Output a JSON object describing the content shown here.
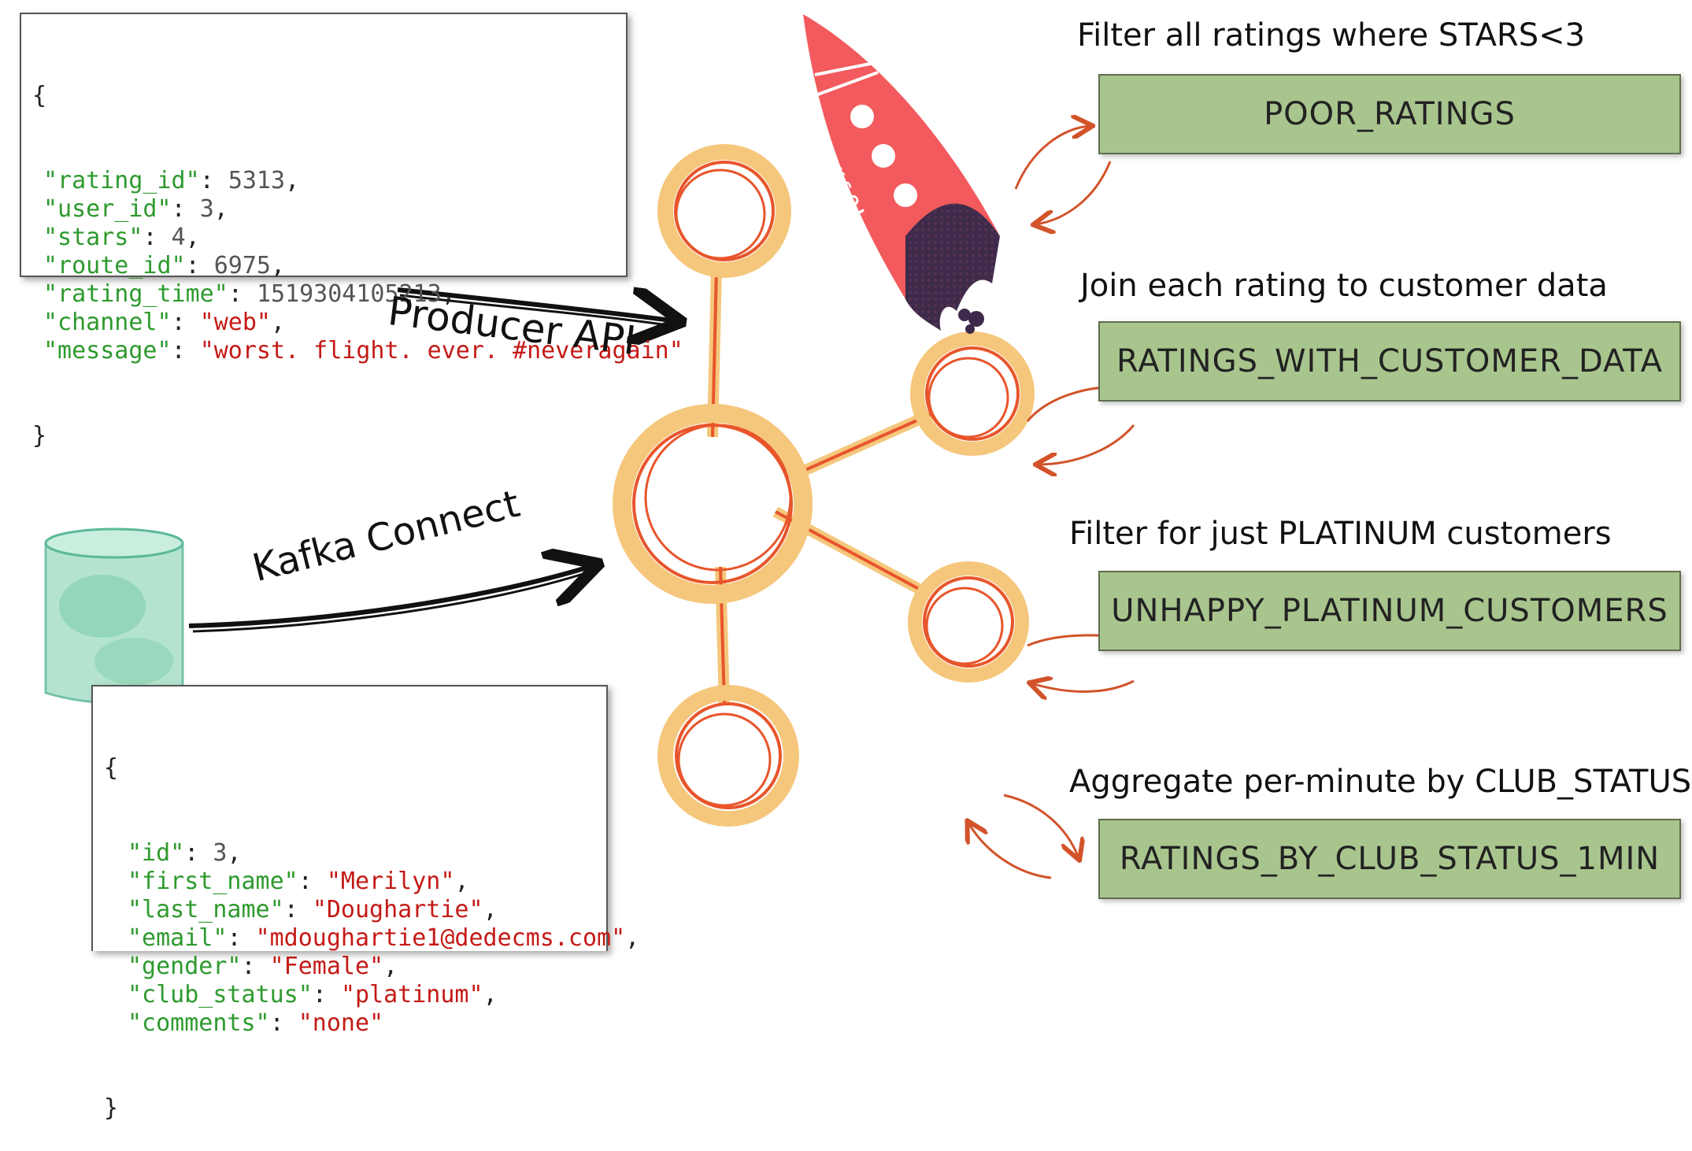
{
  "colors": {
    "broker_stroke": "#e8552b",
    "broker_glow": "#f5c77c",
    "stream_fill": "#a9c58e",
    "arrow": "#d2532a",
    "rocket_body": "#f25a5d",
    "rocket_dark": "#3e2a4a",
    "db_fill": "#8fd3b5",
    "json_key": "#2e9a2e",
    "json_string": "#c41a16"
  },
  "rating_event": {
    "open": "{",
    "close": "}",
    "fields": [
      {
        "key": "\"rating_id\"",
        "sep": ": ",
        "value": "5313",
        "kind": "n",
        "tail": ","
      },
      {
        "key": "\"user_id\"",
        "sep": ": ",
        "value": "3",
        "kind": "n",
        "tail": ","
      },
      {
        "key": "\"stars\"",
        "sep": ": ",
        "value": "4",
        "kind": "n",
        "tail": ","
      },
      {
        "key": "\"route_id\"",
        "sep": ": ",
        "value": "6975",
        "kind": "n",
        "tail": ","
      },
      {
        "key": "\"rating_time\"",
        "sep": ": ",
        "value": "1519304105213",
        "kind": "n",
        "tail": ","
      },
      {
        "key": "\"channel\"",
        "sep": ": ",
        "value": "\"web\"",
        "kind": "s",
        "tail": ","
      },
      {
        "key": "\"message\"",
        "sep": ": ",
        "value": "\"worst. flight. ever. #neveragain\"",
        "kind": "s",
        "tail": ""
      }
    ]
  },
  "customer_record": {
    "open": "{",
    "close": "}",
    "fields": [
      {
        "key": "\"id\"",
        "sep": ": ",
        "value": "3",
        "kind": "n",
        "tail": ","
      },
      {
        "key": "\"first_name\"",
        "sep": ": ",
        "value": "\"Merilyn\"",
        "kind": "s",
        "tail": ","
      },
      {
        "key": "\"last_name\"",
        "sep": ": ",
        "value": "\"Doughartie\"",
        "kind": "s",
        "tail": ","
      },
      {
        "key": "\"email\"",
        "sep": ": ",
        "value": "\"mdoughartie1@dedecms.com\"",
        "kind": "s",
        "tail": ","
      },
      {
        "key": "\"gender\"",
        "sep": ": ",
        "value": "\"Female\"",
        "kind": "s",
        "tail": ","
      },
      {
        "key": "\"club_status\"",
        "sep": ": ",
        "value": "\"platinum\"",
        "kind": "s",
        "tail": ","
      },
      {
        "key": "\"comments\"",
        "sep": ": ",
        "value": "\"none\"",
        "kind": "s",
        "tail": ""
      }
    ]
  },
  "labels": {
    "producer_api": "Producer API",
    "kafka_connect": "Kafka Connect",
    "rocket_text": "KSQL"
  },
  "queries": [
    {
      "description": "Filter all ratings where STARS<3",
      "stream": "POOR_RATINGS"
    },
    {
      "description": "Join each rating to customer data",
      "stream": "RATINGS_WITH_CUSTOMER_DATA"
    },
    {
      "description": "Filter for just PLATINUM customers",
      "stream": "UNHAPPY_PLATINUM_CUSTOMERS"
    },
    {
      "description": "Aggregate per-minute by CLUB_STATUS",
      "stream": "RATINGS_BY_CLUB_STATUS_1MIN"
    }
  ]
}
